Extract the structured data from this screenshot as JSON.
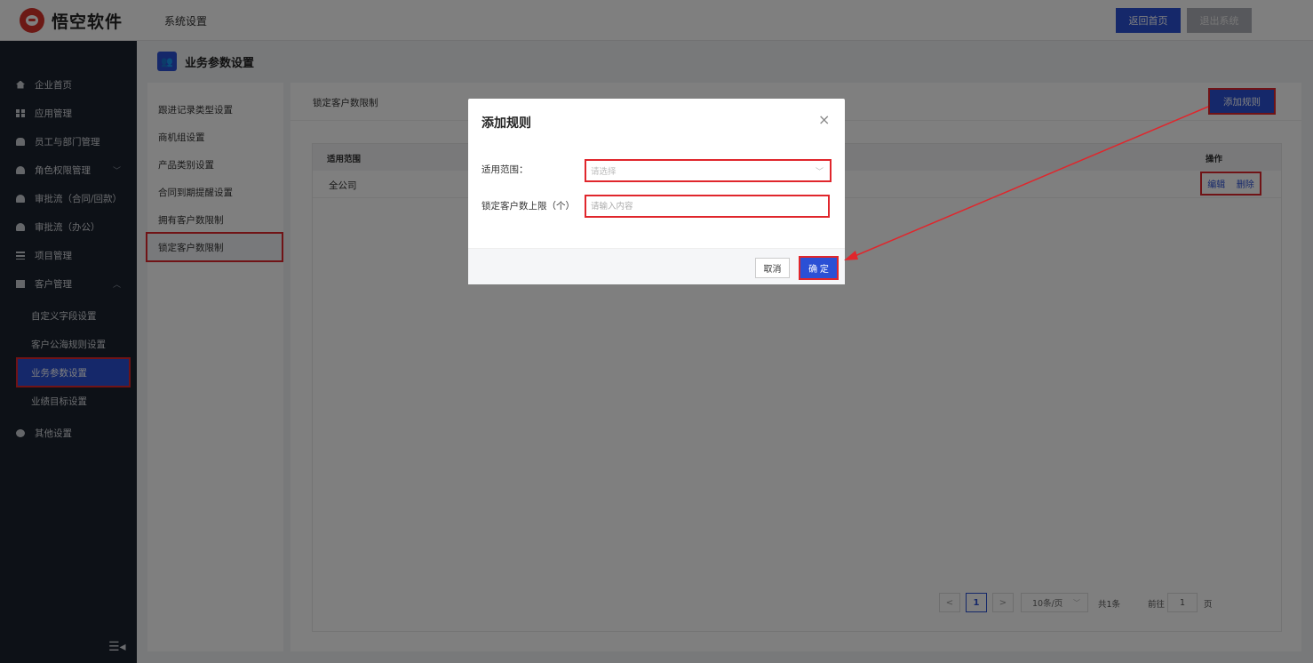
{
  "header": {
    "logo_text": "悟空软件",
    "section_title": "系统设置",
    "home_button": "返回首页",
    "exit_button": "退出系统"
  },
  "sidebar": {
    "items": [
      {
        "label": "企业首页",
        "icon": "home-icon"
      },
      {
        "label": "应用管理",
        "icon": "grid-icon"
      },
      {
        "label": "员工与部门管理",
        "icon": "users-icon"
      },
      {
        "label": "角色权限管理",
        "icon": "user-icon",
        "expand": "﹀"
      },
      {
        "label": "审批流（合同/回款）",
        "icon": "user-icon"
      },
      {
        "label": "审批流（办公）",
        "icon": "user-icon"
      },
      {
        "label": "项目管理",
        "icon": "list-icon"
      },
      {
        "label": "客户管理",
        "icon": "building-icon",
        "expand": "︿"
      },
      {
        "label": "其他设置",
        "icon": "gear-icon"
      }
    ],
    "sub_items": [
      {
        "label": "自定义字段设置"
      },
      {
        "label": "客户公海规则设置"
      },
      {
        "label": "业务参数设置"
      },
      {
        "label": "业绩目标设置"
      }
    ],
    "collapse_glyph": "☰◂"
  },
  "page": {
    "title": "业务参数设置",
    "title_icon": "users-icon"
  },
  "settings_menu": {
    "items": [
      {
        "label": "跟进记录类型设置"
      },
      {
        "label": "商机组设置"
      },
      {
        "label": "产品类别设置"
      },
      {
        "label": "合同到期提醒设置"
      },
      {
        "label": "拥有客户数限制"
      },
      {
        "label": "锁定客户数限制"
      }
    ]
  },
  "main": {
    "title": "锁定客户数限制",
    "add_button": "添加规则",
    "columns": {
      "scope": "适用范围",
      "ops": "操作"
    },
    "rows": [
      {
        "scope": "全公司",
        "edit": "编辑",
        "delete": "删除"
      }
    ],
    "pager": {
      "prev": "<",
      "current": "1",
      "next": ">",
      "page_size": "10条/页",
      "total": "共1条",
      "goto_label": "前往",
      "goto_value": "1",
      "page_unit": "页"
    }
  },
  "dialog": {
    "title": "添加规则",
    "close": "×",
    "scope_label": "适用范围：",
    "scope_placeholder": "请选择",
    "limit_label": "锁定客户数上限（个）",
    "limit_placeholder": "请输入内容",
    "cancel": "取消",
    "ok": "确 定"
  },
  "colors": {
    "accent": "#2b50d5",
    "highlight": "#e0262c",
    "sidebar_bg": "#1a222e"
  }
}
